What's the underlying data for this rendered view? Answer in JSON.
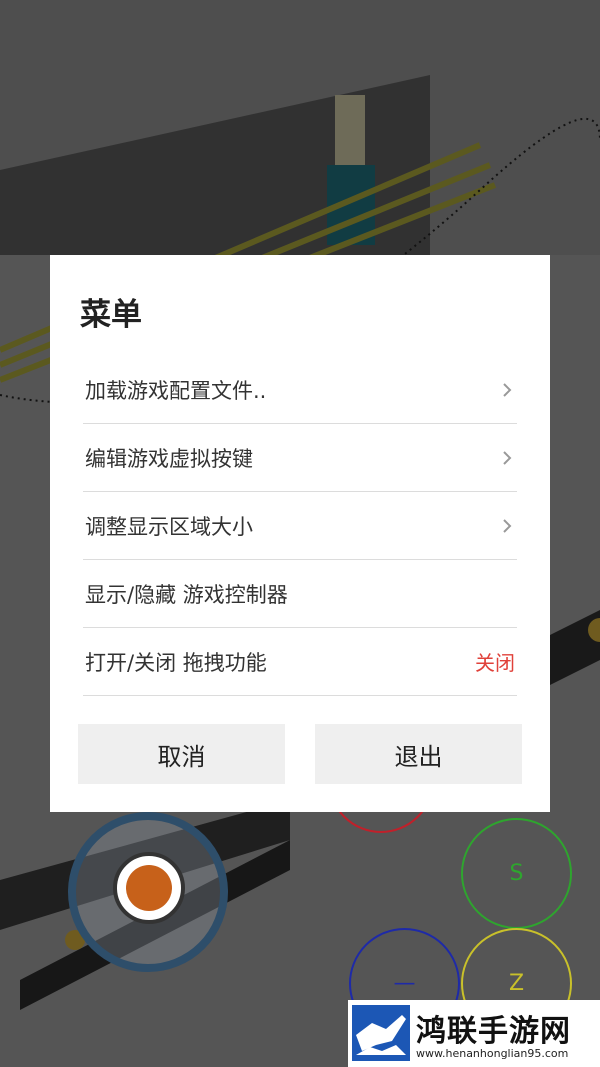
{
  "dialog": {
    "title": "菜单",
    "items": [
      {
        "label": "加载游戏配置文件..",
        "chevron": "chevron-right-icon"
      },
      {
        "label": "编辑游戏虚拟按键",
        "chevron": "chevron-right-icon"
      },
      {
        "label": "调整显示区域大小",
        "chevron": "chevron-right-icon"
      },
      {
        "label": "显示/隐藏 游戏控制器"
      },
      {
        "label": "打开/关闭 拖拽功能",
        "value": "关闭"
      }
    ],
    "cancel_label": "取消",
    "exit_label": "退出"
  },
  "controller": {
    "s_label": "S",
    "z_label": "Z",
    "minus_label": "—"
  },
  "watermark": {
    "text": "鸿联手游网",
    "url": "www.henanhonglian95.com"
  },
  "colors": {
    "value_red": "#e0413a",
    "ctrl_green": "#2ea52e",
    "ctrl_yellow": "#c9c12a",
    "ctrl_blue": "#1e2aa8",
    "ctrl_red": "#c0202a"
  }
}
